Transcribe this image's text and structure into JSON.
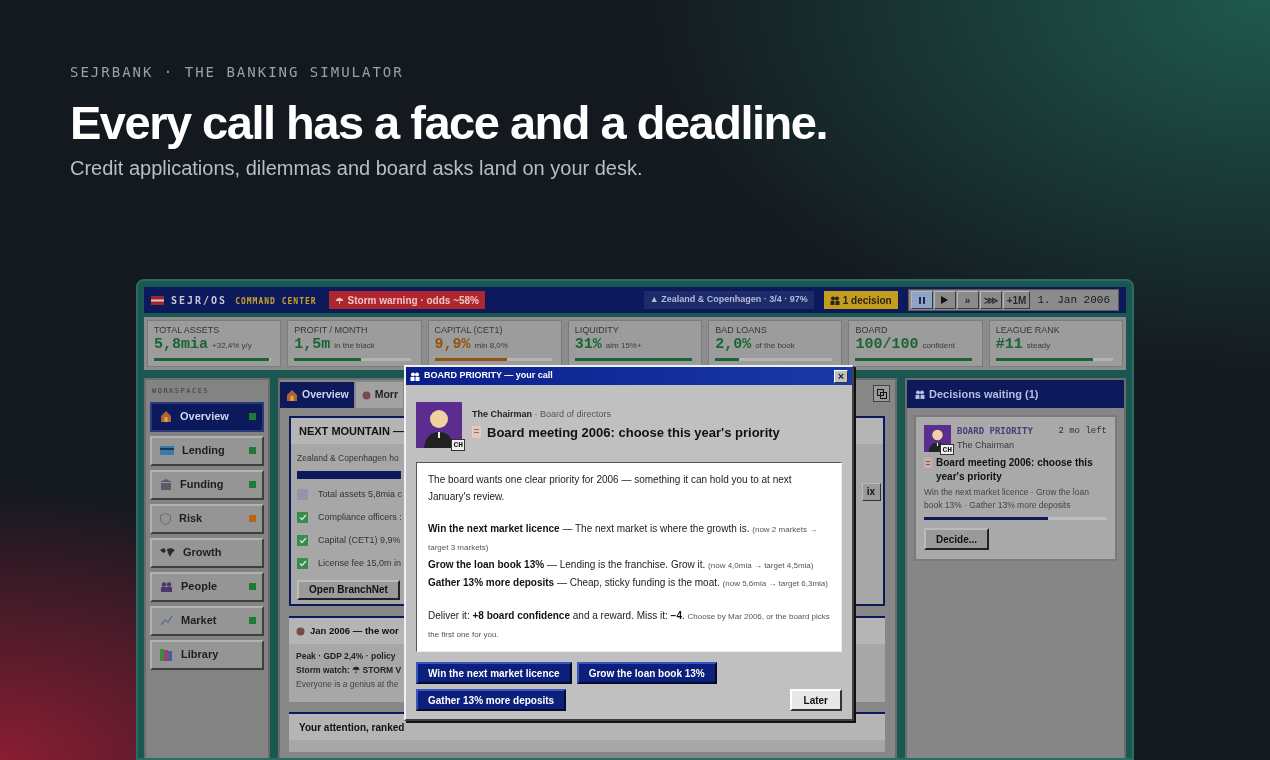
{
  "hero": {
    "eyebrow": "SEJRBANK · THE BANKING SIMULATOR",
    "headline": "Every call has a face and a deadline.",
    "subtitle": "Credit applications, dilemmas and board asks land on your desk."
  },
  "app": {
    "top_bar": {
      "brand": "SEJR/OS",
      "product": "COMMAND CENTER",
      "alert": "Storm warning · odds ~58%",
      "region": "▲ Zealand & Copenhagen · 3/4 · 97%",
      "decisions": "1 decision",
      "controls": [
        {
          "kind": "pause",
          "selected": true
        },
        {
          "kind": "play",
          "selected": false
        },
        {
          "kind": "text",
          "label": "»",
          "selected": false
        },
        {
          "kind": "text",
          "label": "⋙",
          "selected": false
        },
        {
          "kind": "text",
          "label": "+1M",
          "selected": false
        }
      ],
      "date": "1. Jan 2006"
    },
    "kpis": [
      {
        "label": "TOTAL ASSETS",
        "value": "5,8mia",
        "note": "+32,4% y/y",
        "color": "#1a6535",
        "level": 0.98
      },
      {
        "label": "PROFIT / MONTH",
        "value": "1,5m",
        "note": "in the black",
        "color": "#1a6535",
        "level": 0.57
      },
      {
        "label": "CAPITAL (CET1)",
        "value": "9,9%",
        "note": "min 8,0%",
        "color": "#93520e",
        "level": 0.62
      },
      {
        "label": "LIQUIDITY",
        "value": "31%",
        "note": "aim 15%+",
        "color": "#1a6535",
        "level": 1
      },
      {
        "label": "BAD LOANS",
        "value": "2,0%",
        "note": "of the book",
        "color": "#1a6535",
        "level": 0.2
      },
      {
        "label": "BOARD",
        "value": "100/100",
        "note": "confident",
        "color": "#1a6535",
        "level": 1
      },
      {
        "label": "LEAGUE RANK",
        "value": "#11",
        "note": "steady",
        "color": "#1a6535",
        "level": 0.83
      }
    ],
    "sidebar": {
      "heading": "WORKSPACES",
      "items": [
        {
          "label": "Overview",
          "selected": true,
          "color": "#1f7a35"
        },
        {
          "label": "Lending",
          "selected": false,
          "color": "#1f7a35"
        },
        {
          "label": "Funding",
          "selected": false,
          "color": "#1f7a35"
        },
        {
          "label": "Risk",
          "selected": false,
          "color": "#b8621a"
        },
        {
          "label": "Growth",
          "selected": false
        },
        {
          "label": "People",
          "selected": false,
          "color": "#1f7a35"
        },
        {
          "label": "Market",
          "selected": false,
          "color": "#1f7a35"
        },
        {
          "label": "Library",
          "selected": false
        }
      ]
    },
    "tabs": [
      {
        "label": "Overview",
        "selected": true
      },
      {
        "label": "Morr",
        "selected": false
      }
    ],
    "mountain": {
      "title": "NEXT MOUNTAIN —",
      "summary": "Zealand & Copenhagen ho",
      "level": 1,
      "checklist": [
        {
          "text": "Total assets 5,8mia c",
          "checked": false
        },
        {
          "text": "Compliance officers :",
          "checked": true
        },
        {
          "text": "Capital (CET1) 9,9%",
          "checked": true
        },
        {
          "text": "License fee 15,0m in",
          "checked": true
        }
      ],
      "button": "Open BranchNet",
      "side_button": "ix"
    },
    "news": {
      "title": "Jan 2006 — the wor",
      "lines": [
        {
          "text": "Peak · GDP 2,4% · policy",
          "kind": "emphasis"
        },
        {
          "text": "Storm watch: ☂ STORM V",
          "kind": "emphasis"
        },
        {
          "text": "Everyone is a genius at the",
          "kind": "plain"
        }
      ]
    },
    "attention": {
      "title": "Your attention, ranked"
    },
    "decisions_panel": {
      "title": "Decisions waiting (1)",
      "cards": [
        {
          "tag": "BOARD PRIORITY",
          "from": "The Chairman",
          "initials": "CH",
          "due": "2 mo left",
          "title": "Board meeting 2006: choose this year's priority",
          "options": "Win the next market licence · Grow the loan book 13% · Gather 13% more deposits",
          "level": 0.68,
          "button": "Decide..."
        }
      ]
    },
    "modal": {
      "title": "BOARD PRIORITY — your call",
      "close": "×",
      "sender": "The Chairman",
      "role": "· Board of directors",
      "initials": "CH",
      "heading": "Board meeting 2006: choose this year's priority",
      "body": [
        [
          [
            {
              "kind": "plain",
              "text": "The board wants one clear priority for 2006 — something it can hold you to at next January's review."
            }
          ]
        ],
        [
          [
            {
              "kind": "strong",
              "text": "Win the next market licence"
            },
            {
              "kind": "plain",
              "text": " — The next market is where the growth is. "
            },
            {
              "kind": "note",
              "text": "(now 2 markets → target 3 markets)"
            }
          ],
          [
            {
              "kind": "strong",
              "text": "Grow the loan book 13%"
            },
            {
              "kind": "plain",
              "text": " — Lending is the franchise. Grow it. "
            },
            {
              "kind": "note",
              "text": "(now 4,0mia → target 4,5mia)"
            }
          ],
          [
            {
              "kind": "strong",
              "text": "Gather 13% more deposits"
            },
            {
              "kind": "plain",
              "text": " — Cheap, sticky funding is the moat. "
            },
            {
              "kind": "note",
              "text": "(now 5,6mia → target 6,3mia)"
            }
          ]
        ],
        [
          [
            {
              "kind": "plain",
              "text": "Deliver it: "
            },
            {
              "kind": "strong",
              "text": "+8 board confidence"
            },
            {
              "kind": "plain",
              "text": " and a reward. Miss it: "
            },
            {
              "kind": "strong",
              "text": "−4"
            },
            {
              "kind": "plain",
              "text": ". "
            },
            {
              "kind": "note",
              "text": "Choose by Mar 2006, or the board picks the first one for you."
            }
          ]
        ]
      ],
      "choices": [
        "Win the next market licence",
        "Grow the loan book 13%",
        "Gather 13% more deposits"
      ],
      "dismiss": "Later"
    }
  }
}
